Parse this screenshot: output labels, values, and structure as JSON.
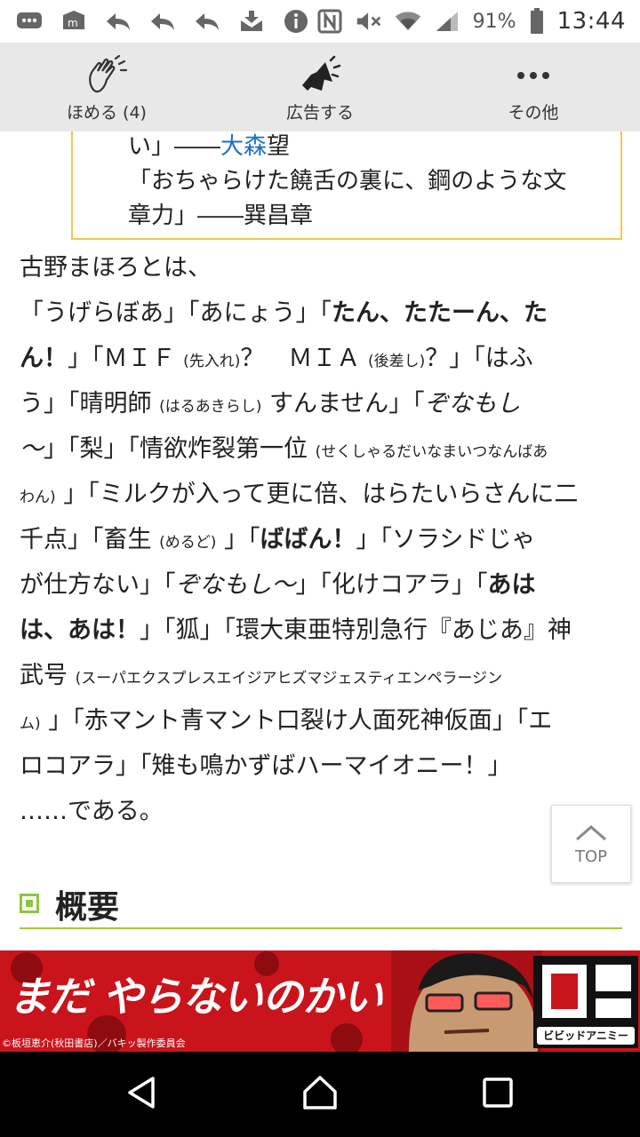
{
  "status_bar": {
    "battery": "91%",
    "time": "13:44",
    "left_icons": [
      "chat-icon",
      "mail-icon",
      "reply-icon",
      "reply-icon",
      "reply-icon",
      "download-icon",
      "info-icon"
    ],
    "right_icons": [
      "nfc-icon",
      "mute-icon",
      "wifi-icon",
      "signal-icon",
      "battery-icon"
    ]
  },
  "toolbar": {
    "praise_label": "ほめる (4)",
    "ad_label": "広告する",
    "more_label": "その他"
  },
  "quote": {
    "line1_a": "い」――",
    "line1_link": "大森",
    "line1_b": "望",
    "line2": "「おちゃらけた饒舌の裏に、鋼のような文",
    "line3": "章力」――巽昌章"
  },
  "article": {
    "l1": "古野まほろとは、",
    "l2a": "「うげらぼあ」「あにょう」「",
    "l2b": "たん、たたーん、た",
    "l3a": "ん！",
    "l3b": "」「ＭＩＦ",
    "l3c": "(先入れ)",
    "l3d": "？　ＭＩＡ",
    "l3e": "(後差し)",
    "l3f": "？」「はふ",
    "l4a": "う」「晴明師",
    "l4b": "(はるあきらし)",
    "l4c": "すんません」「",
    "l4d": "ぞなもし",
    "l5a": "〜",
    "l5b": "」「梨」「情欲炸裂第一位",
    "l5c": "(せくしゃるだいなまいつなんばあ",
    "l6a": "わん)",
    "l6b": "」「ミルクが入って更に倍、はらたいらさんに二",
    "l7a": "千点」「畜生",
    "l7b": "(めるど)",
    "l7c": "」「",
    "l7d": "ばばん！",
    "l7e": "」「ソラシドじゃ",
    "l8a": "が仕方ない」「",
    "l8b": "ぞなもし〜",
    "l8c": "」「化けコアラ」「",
    "l8d": "あは",
    "l9a": "は、あは！",
    "l9b": "」「狐」「環大東亜特別急行『あじあ』神",
    "l10a": "武号",
    "l10b": "(スーパエクスプレスエイジアヒズマジェスティエンペラージン",
    "l11a": "ム)",
    "l11b": "」「赤マント青マント口裂け人面死神仮面」「エ",
    "l12": "ロコアラ」「雉も鳴かずばハーマイオニー！」",
    "l13": "……である。"
  },
  "section": {
    "title": "概要"
  },
  "top_button": {
    "label": "TOP"
  },
  "ad_banner": {
    "headline": "まだ やらないのかい",
    "copyright": "©板垣恵介(秋田書店)／バキッ製作委員会",
    "logo_text": "ビビッドアニミー"
  },
  "colors": {
    "link": "#1a6fc7",
    "accent_green": "#8cc63f",
    "quote_border": "#f0c84a",
    "ad_red": "#c9141b"
  }
}
